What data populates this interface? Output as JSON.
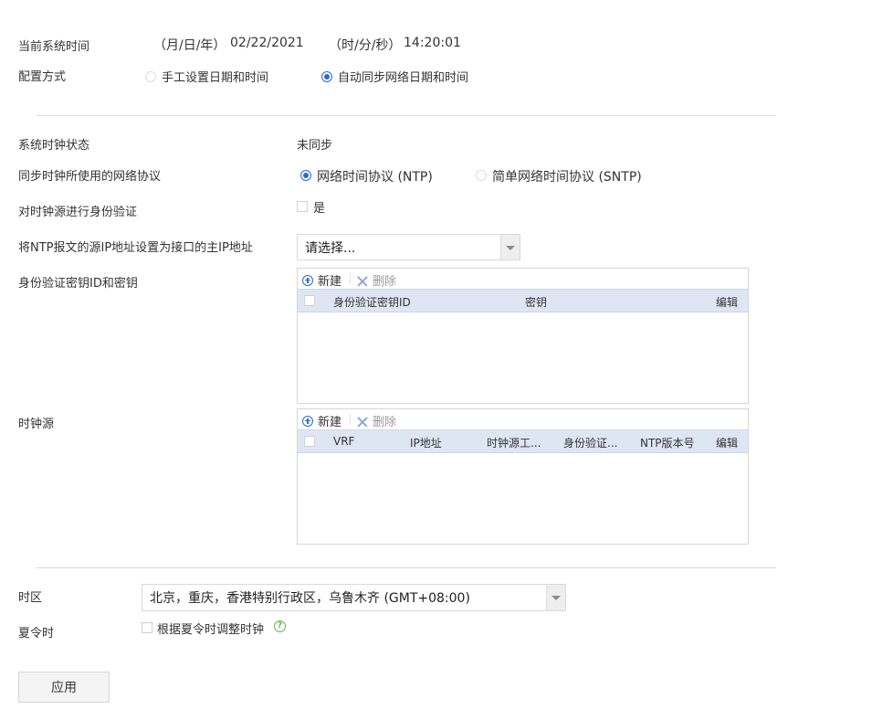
{
  "system_time": {
    "label": "当前系统时间",
    "date_prefix": "（月/日/年）",
    "date": "02/22/2021",
    "time_prefix": "（时/分/秒）",
    "time": "14:20:01"
  },
  "config_mode": {
    "label": "配置方式",
    "options": [
      "手工设置日期和时间",
      "自动同步网络日期和时间"
    ],
    "selected": "自动同步网络日期和时间"
  },
  "clock_status": {
    "label": "系统时钟状态",
    "value": "未同步"
  },
  "protocol": {
    "label": "同步时钟所使用的网络协议",
    "options": [
      "网络时间协议 (NTP)",
      "简单网络时间协议 (SNTP)"
    ],
    "selected": "网络时间协议 (NTP)"
  },
  "auth": {
    "label": "对时钟源进行身份验证",
    "checkbox_label": "是",
    "checked": false
  },
  "source_ip": {
    "label": "将NTP报文的源IP地址设置为接口的主IP地址",
    "placeholder": "请选择..."
  },
  "auth_keys": {
    "label": "身份验证密钥ID和密钥",
    "new_label": "新建",
    "delete_label": "删除",
    "columns": [
      "身份验证密钥ID",
      "密钥",
      "编辑"
    ]
  },
  "clock_source": {
    "label": "时钟源",
    "new_label": "新建",
    "delete_label": "删除",
    "columns": [
      "VRF",
      "IP地址",
      "时钟源工...",
      "身份验证...",
      "NTP版本号",
      "编辑"
    ]
  },
  "timezone": {
    "label": "时区",
    "value": "北京，重庆，香港特别行政区，乌鲁木齐 (GMT+08:00)"
  },
  "dst": {
    "label": "夏令时",
    "checkbox_label": "根据夏令时调整时钟",
    "help": "?"
  },
  "apply_label": "应用",
  "colors": {
    "accent": "#2a6ad2",
    "header_bg": "#dfe6f3",
    "help": "#5fb24a"
  }
}
